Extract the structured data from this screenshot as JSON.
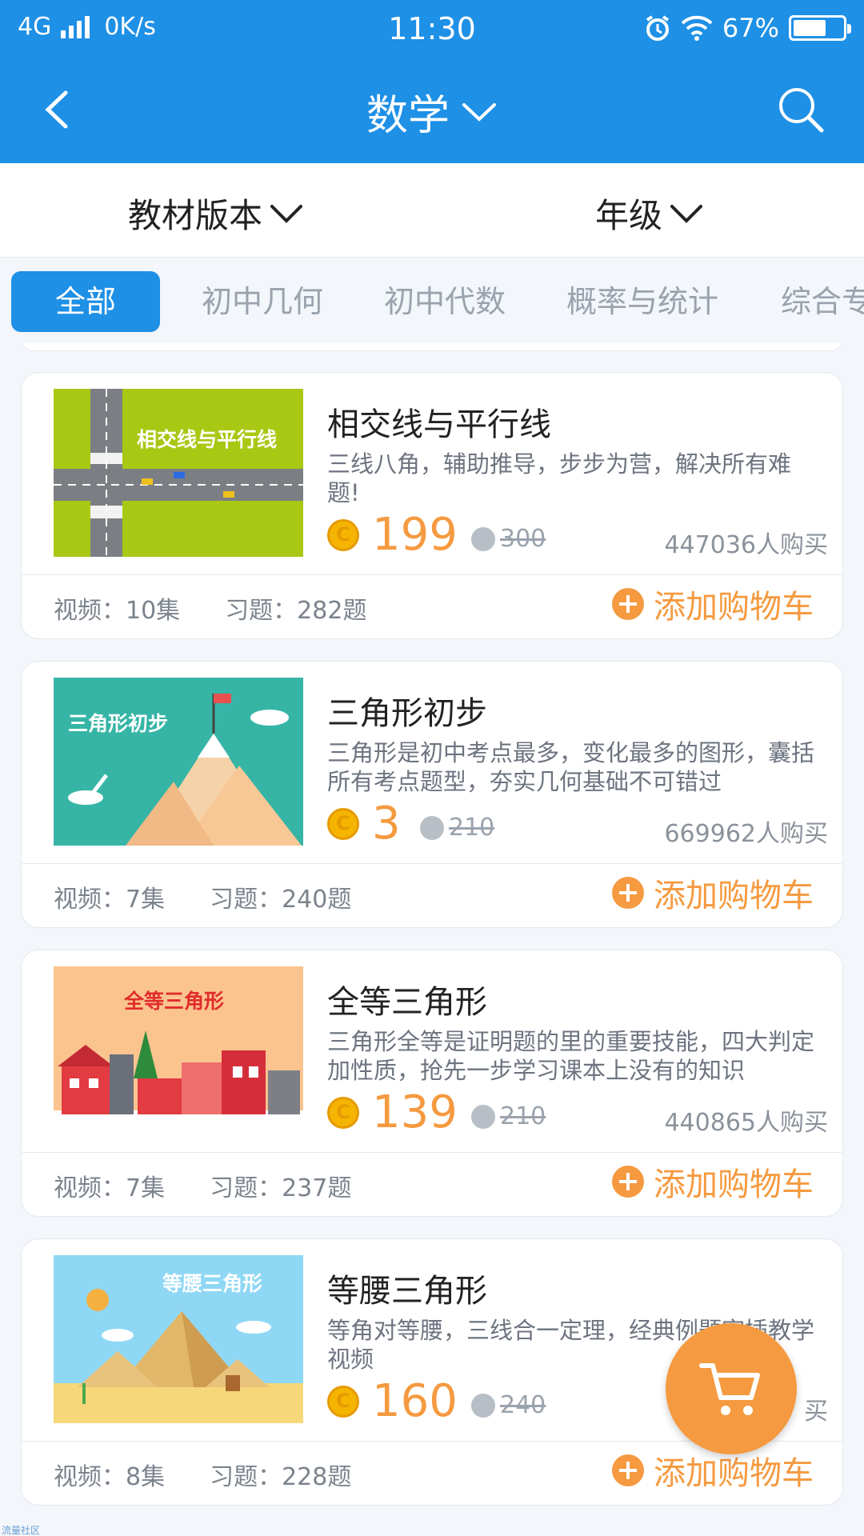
{
  "status_bar": {
    "network": "4G",
    "speed": "0K/s",
    "time": "11:30",
    "battery": "67%",
    "battery_level": 0.67
  },
  "header": {
    "title": "数学"
  },
  "filters": {
    "textbook": "教材版本",
    "grade": "年级"
  },
  "tabs": [
    {
      "label": "全部",
      "active": true
    },
    {
      "label": "初中几何"
    },
    {
      "label": "初中代数"
    },
    {
      "label": "概率与统计"
    },
    {
      "label": "综合专"
    }
  ],
  "courses": [
    {
      "title": "相交线与平行线",
      "thumb_text": "相交线与平行线",
      "description": "三线八角，辅助推导，步步为营，解决所有难题!",
      "price": "199",
      "original_price": "300",
      "buyers": "447036人购买",
      "videos": "视频：10集",
      "exercises": "习题：282题",
      "add_cart": "添加购物车"
    },
    {
      "title": "三角形初步",
      "thumb_text": "三角形初步",
      "description": "三角形是初中考点最多，变化最多的图形，囊括所有考点题型，夯实几何基础不可错过",
      "price": "3",
      "original_price": "210",
      "buyers": "669962人购买",
      "videos": "视频：7集",
      "exercises": "习题：240题",
      "add_cart": "添加购物车"
    },
    {
      "title": "全等三角形",
      "thumb_text": "全等三角形",
      "description": "三角形全等是证明题的里的重要技能，四大判定加性质，抢先一步学习课本上没有的知识",
      "price": "139",
      "original_price": "210",
      "buyers": "440865人购买",
      "videos": "视频：7集",
      "exercises": "习题：237题",
      "add_cart": "添加购物车"
    },
    {
      "title": "等腰三角形",
      "thumb_text": "等腰三角形",
      "description": "等角对等腰，三线合一定理，经典例题穿插教学视频",
      "price": "160",
      "original_price": "240",
      "buyers": "买",
      "videos": "视频：8集",
      "exercises": "习题：228题",
      "add_cart": "添加购物车"
    }
  ],
  "watermark": "流量社区",
  "colors": {
    "primary": "#1e90e6",
    "accent": "#f59a40"
  }
}
